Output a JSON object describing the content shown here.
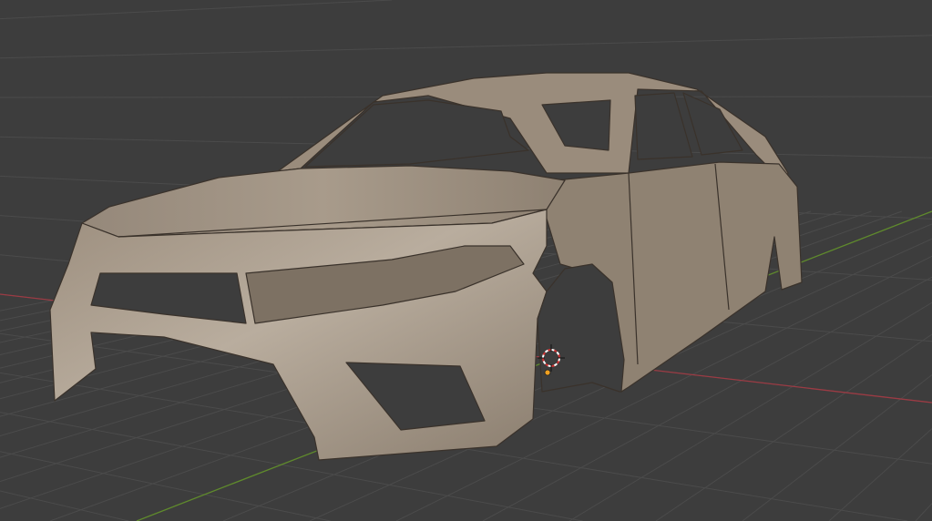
{
  "viewport": {
    "background_color": "#3d3d3d",
    "grid_color": "#4b4b4b",
    "x_axis_color": "#9b3b44",
    "y_axis_color": "#5f8a2c",
    "model_color": "#a69886",
    "model_edge_color": "#3a322b"
  },
  "icons": {
    "cursor": "3d-cursor-icon",
    "origin": "object-origin-icon"
  }
}
